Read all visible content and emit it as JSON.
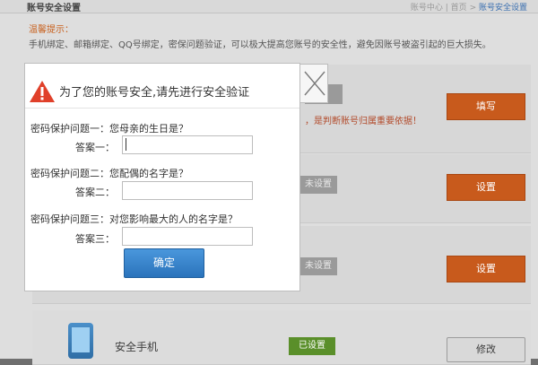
{
  "background": {
    "header_title": "账号安全设置",
    "breadcrumb_left": "账号中心",
    "breadcrumb_sep": "|",
    "breadcrumb_home": "首页",
    "breadcrumb_link": "账号安全设置",
    "tip_label": "温馨提示：",
    "tip_text": "手机绑定、邮箱绑定、QQ号绑定，密保问题验证，可以极大提高您账号的安全性，避免因账号被盗引起的巨大损失。",
    "warn_small": "，是判断账号归属重要依据！",
    "rows": [
      {
        "tag": "",
        "button": "填写"
      },
      {
        "tag": "未设置",
        "button": "设置"
      },
      {
        "tag": "未设置",
        "button": "设置"
      },
      {
        "label": "安全手机",
        "tag": "已设置",
        "button": "修改"
      }
    ]
  },
  "modal": {
    "title": "为了您的账号安全,请先进行安全验证",
    "questions": [
      {
        "question": "密码保护问题一：您母亲的生日是？",
        "answer_label": "答案一：",
        "answer_value": ""
      },
      {
        "question": "密码保护问题二：您配偶的名字是？",
        "answer_label": "答案二：",
        "answer_value": ""
      },
      {
        "question": "密码保护问题三：对您影响最大的人的名字是？",
        "answer_label": "答案三：",
        "answer_value": ""
      }
    ],
    "confirm_label": "确定"
  },
  "colors": {
    "accent_blue": "#2a73bb",
    "warning_red": "#e0402a",
    "orange_button": "#c85a1c",
    "green_tag": "#5a8f2a"
  },
  "icons": {
    "warning": "warning-triangle-icon",
    "close": "close-x-icon",
    "phone": "phone-icon"
  }
}
